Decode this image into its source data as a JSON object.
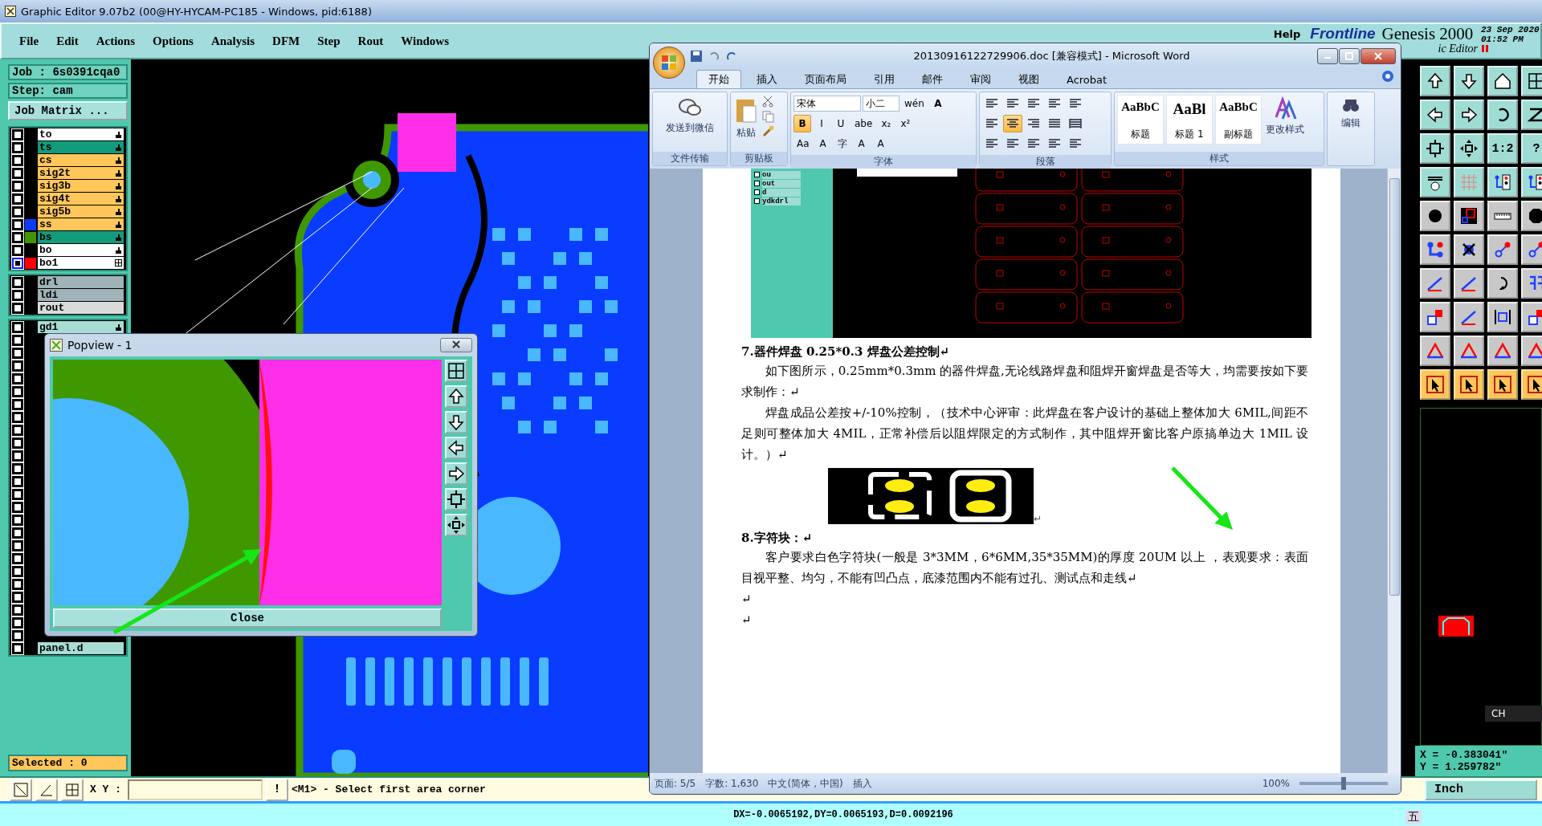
{
  "title_bar": {
    "title": "Graphic Editor 9.07b2 (00@HY-HYCAM-PC185 - Windows, pid:6188)"
  },
  "menu": [
    "File",
    "Edit",
    "Actions",
    "Options",
    "Analysis",
    "DFM",
    "Step",
    "Rout",
    "Windows"
  ],
  "header": {
    "help": "Help",
    "logo": "Frontline",
    "product": "Genesis 2000",
    "subtitle": "ic Editor",
    "date": "23 Sep 2020",
    "time": "01:52 PM"
  },
  "job": "Job : 6s0391cqa0",
  "step": "Step: cam",
  "job_matrix_button": "Job Matrix ...",
  "layer_groups": [
    [
      {
        "name": "to",
        "color": "#ffffff",
        "kind": "hand",
        "selected": false
      },
      {
        "name": "ts",
        "color": "#139c7c",
        "kind": "hand",
        "selected": false
      },
      {
        "name": "cs",
        "color": "#ffc65a",
        "kind": "hand",
        "selected": false
      },
      {
        "name": "sig2t",
        "color": "#ffc65a",
        "kind": "hand",
        "selected": false
      },
      {
        "name": "sig3b",
        "color": "#ffc65a",
        "kind": "hand",
        "selected": false
      },
      {
        "name": "sig4t",
        "color": "#ffc65a",
        "kind": "hand",
        "selected": false
      },
      {
        "name": "sig5b",
        "color": "#ffc65a",
        "kind": "hand",
        "selected": false
      },
      {
        "name": "ss",
        "color": "#ffc65a",
        "swatch": {
          "color": "#0a3cff"
        },
        "kind": "hand",
        "selected": false
      },
      {
        "name": "bs",
        "color": "#139c7c",
        "swatch": {
          "color": "#3f9800"
        },
        "kind": "hand",
        "selected": false
      },
      {
        "name": "bo",
        "color": "#ffffff",
        "kind": "hand",
        "selected": false
      },
      {
        "name": "bo1",
        "color": "#ffffff",
        "swatch": {
          "color": "#ff0000"
        },
        "kind": "grid",
        "selected": true
      }
    ],
    [
      {
        "name": "drl",
        "color": "#9fb3b8",
        "selected": false
      },
      {
        "name": "ldi",
        "color": "#9fb3b8",
        "selected": false
      },
      {
        "name": "rout",
        "color": "#dadada",
        "selected": false
      }
    ],
    [
      {
        "name": "gd1",
        "color": "#a8dcd4",
        "kind": "hand",
        "selected": false
      },
      {
        "selected": false
      },
      {
        "selected": false
      },
      {
        "selected": false
      },
      {
        "selected": false
      },
      {
        "selected": false
      },
      {
        "selected": false
      },
      {
        "selected": false
      },
      {
        "selected": false
      },
      {
        "selected": false
      },
      {
        "selected": false
      },
      {
        "selected": false
      },
      {
        "selected": false
      },
      {
        "selected": false
      },
      {
        "selected": false
      },
      {
        "selected": false
      },
      {
        "selected": false
      },
      {
        "selected": false
      },
      {
        "selected": false
      },
      {
        "selected": false
      },
      {
        "selected": false
      },
      {
        "selected": false
      },
      {
        "selected": false
      },
      {
        "selected": false
      },
      {
        "selected": false
      },
      {
        "name": "panel.d",
        "color": "#a8dcd4",
        "selected": false
      }
    ]
  ],
  "selected_count": "Selected : 0",
  "popview": {
    "title": "Popview - 1",
    "close_button": "Close"
  },
  "word": {
    "title": "20130916122729906.doc [兼容模式] - Microsoft Word",
    "tabs": [
      {
        "label": "开始",
        "selected": true
      },
      {
        "label": "插入",
        "selected": false
      },
      {
        "label": "页面布局",
        "selected": false
      },
      {
        "label": "引用",
        "selected": false
      },
      {
        "label": "邮件",
        "selected": false
      },
      {
        "label": "审阅",
        "selected": false
      },
      {
        "label": "视图",
        "selected": false
      },
      {
        "label": "Acrobat",
        "selected": false
      }
    ],
    "send_button": "发送到微信",
    "paste_button": "粘贴",
    "font_name": "宋体",
    "font_size": "小二",
    "phonetic_button": "wén",
    "border_button": "A",
    "format_buttons": [
      {
        "label": "B",
        "selected": true
      },
      {
        "label": "I",
        "selected": false
      },
      {
        "label": "U",
        "selected": false
      },
      {
        "label": "abe",
        "selected": false
      },
      {
        "label": "x₂",
        "selected": false
      },
      {
        "label": "x²",
        "selected": false
      }
    ],
    "font_tools": [
      "Aa",
      "A",
      "字",
      "A",
      "A"
    ],
    "align_buttons": [
      {
        "selected": false
      },
      {
        "selected": true
      },
      {
        "selected": false
      },
      {
        "selected": false
      },
      {
        "selected": false
      }
    ],
    "styles": [
      {
        "preview": "AaBbC",
        "label": "标题"
      },
      {
        "preview": "AaBl",
        "label": "标题 1"
      },
      {
        "preview": "AaBbC",
        "label": "副标题"
      }
    ],
    "change_styles": "更改样式",
    "edit_button": "编辑",
    "groups": [
      "文件传输",
      "剪贴板",
      "字体",
      "段落",
      "样式"
    ],
    "image_layers": [
      {
        "name": "ou",
        "selected": false
      },
      {
        "name": "out",
        "selected": false
      },
      {
        "name": "d",
        "selected": false
      },
      {
        "name": "ydkdrl",
        "selected": false
      }
    ],
    "paragraphs": [
      {
        "kind": "heading",
        "text": "7.器件焊盘 0.25*0.3 焊盘公差控制↵"
      },
      {
        "kind": "body",
        "text": "如下图所示，0.25mm*0.3mm  的器件焊盘,无论线路焊盘和阻焊开窗焊盘是否等大，均需要按如下要求制作：↵"
      },
      {
        "kind": "body",
        "text": "焊盘成品公差按+/-10%控制，（技术中心评审：此焊盘在客户设计的基础上整体加大 6MIL,间距不足则可整体加大 4MIL，正常补偿后以阻焊限定的方式制作，其中阻焊开窗比客户原搞单边大 1MIL 设计。）↵"
      },
      {
        "kind": "image",
        "text": "↵"
      },
      {
        "kind": "heading",
        "text": "8.字符块：↵"
      },
      {
        "kind": "body",
        "text": "客户要求白色字符块(一般是 3*3MM，6*6MM,35*35MM)的厚度 20UM 以上 ，表观要求：表面目视平整、均匀，不能有凹凸点，底漆范围内不能有过孔、测试点和走线↵"
      },
      {
        "kind": "empty",
        "text": "↵"
      },
      {
        "kind": "empty",
        "text": "↵"
      }
    ],
    "status": [
      "页面: 5/5",
      "字数: 1,630",
      "中文(简体，中国)",
      "插入"
    ],
    "zoom": "100%",
    "zoom_slider": {
      "level": 0.5
    }
  },
  "tool_labels": [
    "1:2",
    "?"
  ],
  "coords": {
    "x": "X = -0.383041\"",
    "y": "Y = 1.259782\""
  },
  "language_bar": "CH",
  "command_bar": {
    "label": "X Y :",
    "alert_button": "!",
    "prompt": "<M1> - Select first area corner",
    "units_button": "Inch"
  },
  "status_line": "DX=-0.0065192,DY=0.0065193,D=0.0092196",
  "ime": "五"
}
